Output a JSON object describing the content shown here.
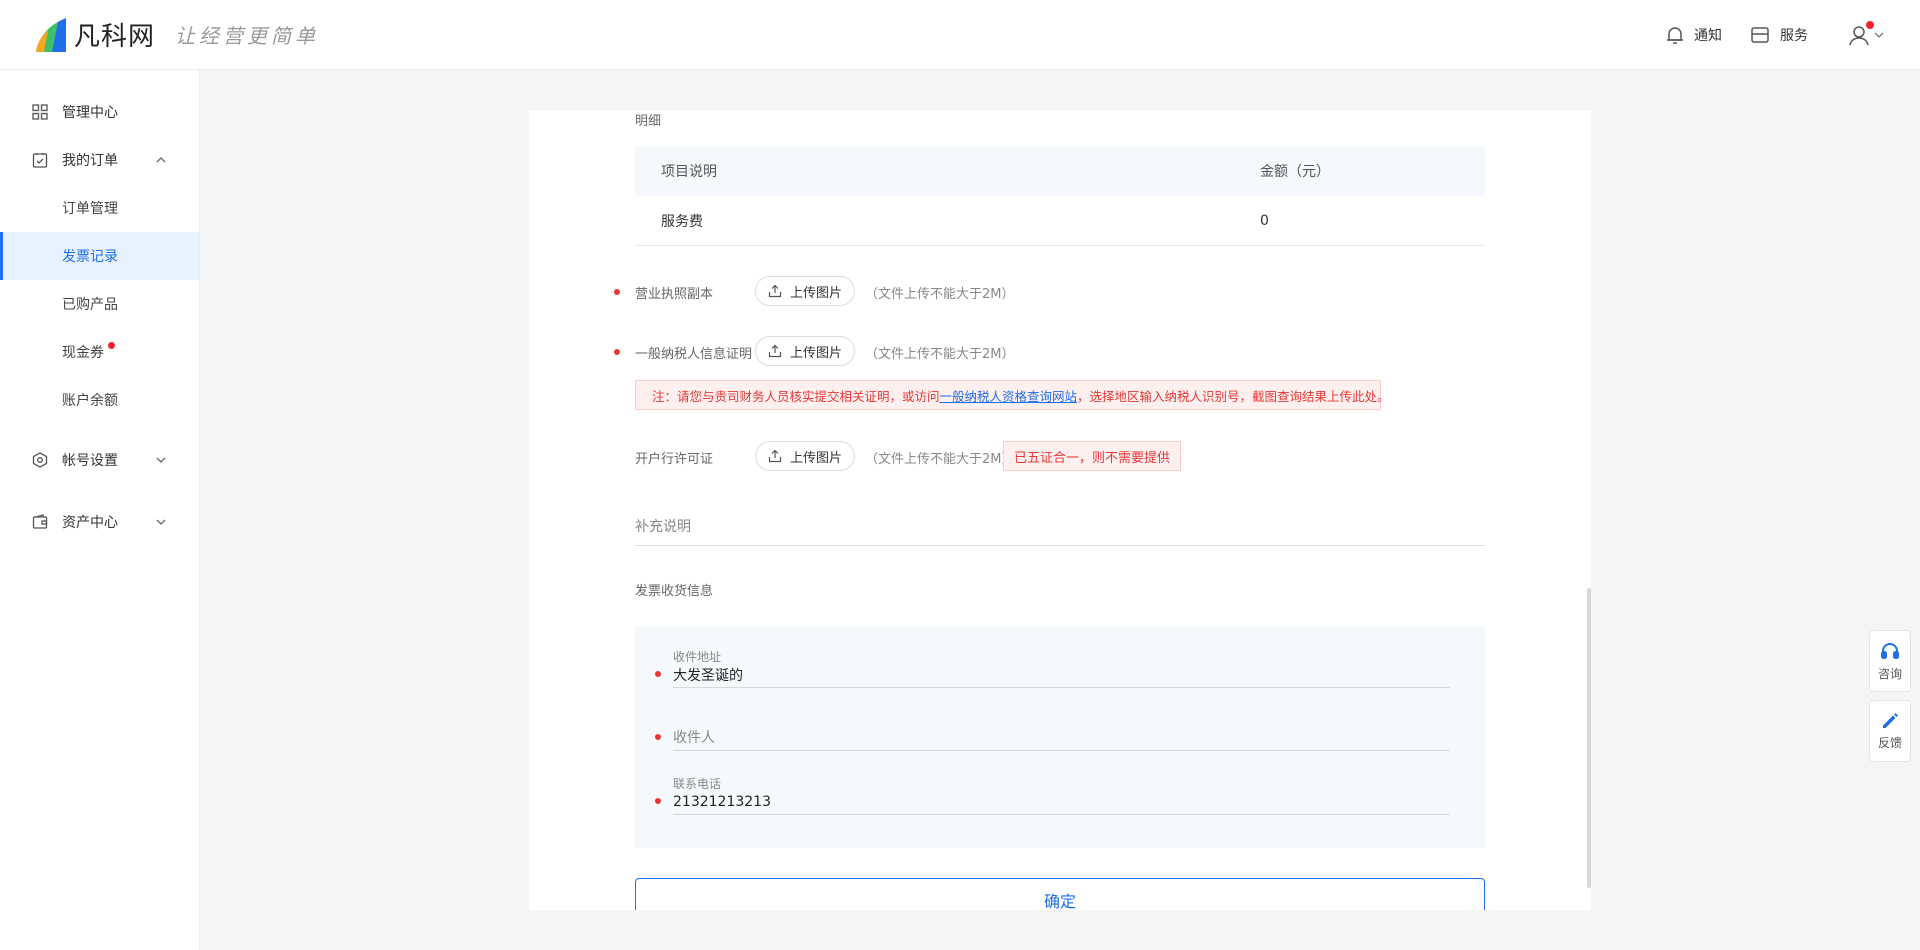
{
  "header": {
    "brand_name": "凡科网",
    "slogan": "让经营更简单",
    "notify_label": "通知",
    "service_label": "服务"
  },
  "sidebar": {
    "management_center": "管理中心",
    "my_orders": "我的订单",
    "orders_sub": [
      "订单管理",
      "发票记录",
      "已购产品",
      "现金券",
      "账户余额"
    ],
    "account_settings": "帐号设置",
    "asset_center": "资产中心"
  },
  "detail": {
    "section_label": "明细",
    "columns": [
      "项目说明",
      "金额（元）"
    ],
    "rows": [
      {
        "item": "服务费",
        "amount": "0"
      }
    ]
  },
  "uploads": {
    "button_label": "上传图片",
    "size_hint": "（文件上传不能大于2M）",
    "business_license": "营业执照副本",
    "taxpayer_cert": "一般纳税人信息证明",
    "bank_permit": "开户行许可证"
  },
  "notice": {
    "prefix": "注：请您与贵司财务人员核实提交相关证明，或访问",
    "link": "一般纳税人资格查询网站",
    "suffix": "，选择地区输入纳税人识别号，截图查询结果上传此处。"
  },
  "bank_tag": "已五证合一，则不需要提供",
  "supplement": {
    "placeholder": "补充说明"
  },
  "shipping": {
    "section_label": "发票收货信息",
    "address_label": "收件地址",
    "address_value": "大发圣诞的",
    "recipient_placeholder": "收件人",
    "phone_label": "联系电话",
    "phone_value": "21321213213"
  },
  "confirm_label": "确定",
  "float": {
    "consult": "咨询",
    "feedback": "反馈"
  },
  "colors": {
    "accent": "#1e6fe8",
    "danger": "#e53935"
  }
}
